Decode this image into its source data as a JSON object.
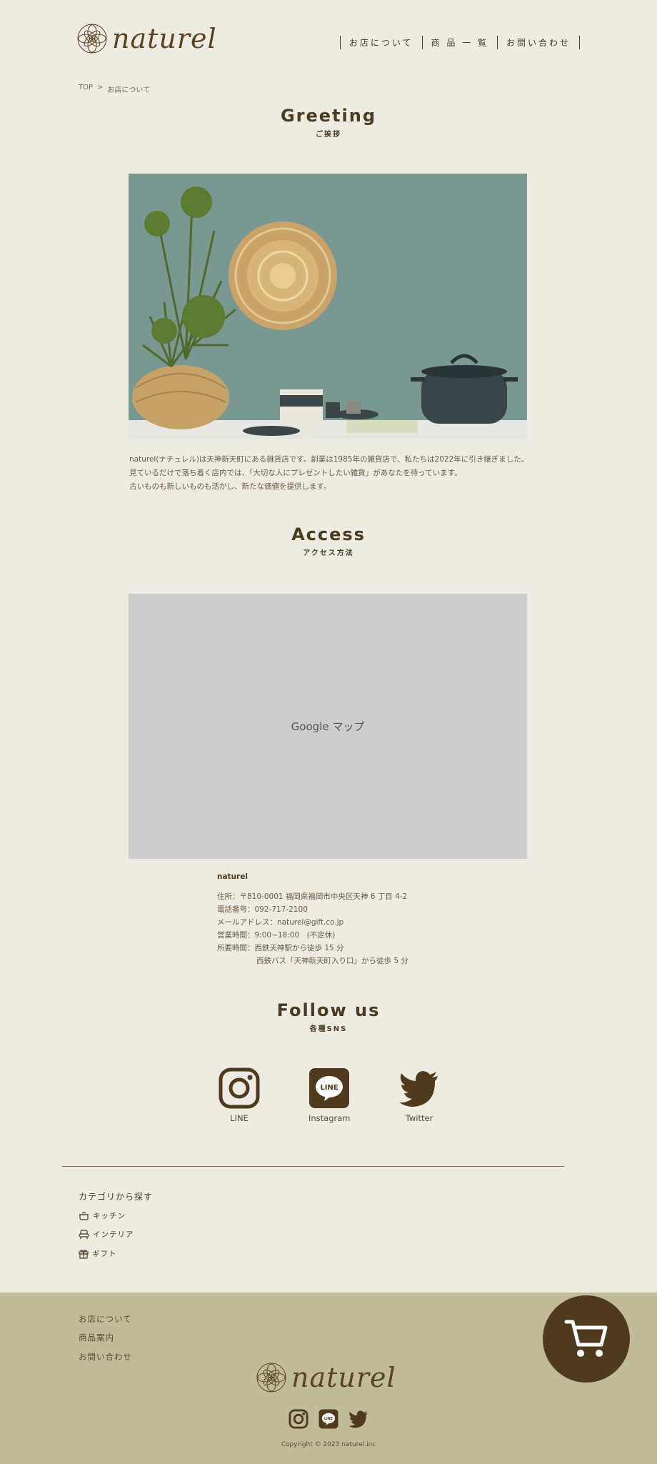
{
  "header": {
    "logo_text": "naturel",
    "nav": [
      "お店について",
      "商 品 一 覧",
      "お問い合わせ"
    ]
  },
  "breadcrumb": {
    "home": "TOP",
    "sep": ">",
    "current": "お店について"
  },
  "greeting": {
    "title_en": "Greeting",
    "title_jp": "ご挨拶",
    "lines": [
      "naturel(ナチュレル)は天神新天町にある雑貨店です。創業は1985年の雑貨店で、私たちは2022年に引き継ぎました。",
      "見ているだけで落ち着く店内では、「大切な人にプレゼントしたい雑貨」があなたを待っています。",
      "古いものも新しいものも活かし、新たな価値を提供します。"
    ]
  },
  "access": {
    "title_en": "Access",
    "title_jp": "アクセス方法",
    "map_label": "Google マップ",
    "shop_name": "naturel",
    "rows": [
      {
        "label": "住所：",
        "value": "〒810-0001 福岡県福岡市中央区天神 6 丁目 4-2"
      },
      {
        "label": "電話番号：",
        "value": "092-717-2100"
      },
      {
        "label": "メールアドレス：",
        "value": "naturel@gift.co.jp"
      },
      {
        "label": "営業時間：",
        "value": "9:00~18:00　(不定休)"
      },
      {
        "label": "所要時間：",
        "value": "西鉄天神駅から徒歩 15 分"
      }
    ],
    "extra_line": "西鉄バス「天神新天町入り口」から徒歩 5 分"
  },
  "follow": {
    "title_en": "Follow us",
    "title_jp": "各種SNS",
    "items": [
      {
        "label": "LINE",
        "icon": "instagram-icon"
      },
      {
        "label": "Instagram",
        "icon": "line-icon"
      },
      {
        "label": "Twitter",
        "icon": "twitter-icon"
      }
    ]
  },
  "categories": {
    "title": "カテゴリから探す",
    "items": [
      {
        "label": "キッチン",
        "icon": "pot-icon"
      },
      {
        "label": "インテリア",
        "icon": "chair-icon"
      },
      {
        "label": "ギフト",
        "icon": "gift-icon"
      }
    ]
  },
  "footer": {
    "links": [
      "お店について",
      "商品案内",
      "お問い合わせ"
    ],
    "logo_text": "naturel",
    "copyright": "Copyright © 2023 naturel.inc"
  },
  "colors": {
    "background": "#edebe2",
    "footer": "#c0bc98",
    "brand_brown": "#4f3a1d"
  }
}
